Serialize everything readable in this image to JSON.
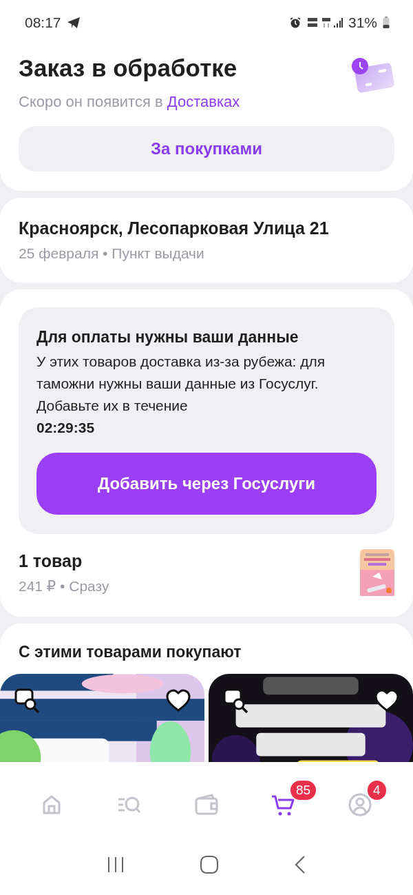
{
  "status_bar": {
    "time": "08:17",
    "battery": "31%"
  },
  "header": {
    "title": "Заказ в обработке",
    "subtitle": "Скоро он появится в",
    "subtitle_link": "Доставках",
    "button": "За покупками"
  },
  "delivery": {
    "address": "Красноярск, Лесопарковая Улица 21",
    "details": "25 февраля • Пункт выдачи"
  },
  "notice": {
    "title": "Для оплаты нужны ваши данные",
    "text": "У этих товаров доставка из-за рубежа: для таможни нужны ваши данные из Госуслуг. Добавьте их в течение",
    "timer": "02:29:35",
    "button": "Добавить через Госуслуги"
  },
  "items": {
    "count": "1 товар",
    "details": "241 ₽ • Сразу"
  },
  "recommendations": {
    "title": "С этими товарами покупают"
  },
  "nav": [
    {
      "kind": "home",
      "selected": false
    },
    {
      "kind": "catalog",
      "selected": false
    },
    {
      "kind": "wallet",
      "selected": false
    },
    {
      "kind": "cart",
      "selected": true,
      "badge": "85"
    },
    {
      "kind": "profile",
      "selected": false,
      "badge": "4"
    }
  ]
}
